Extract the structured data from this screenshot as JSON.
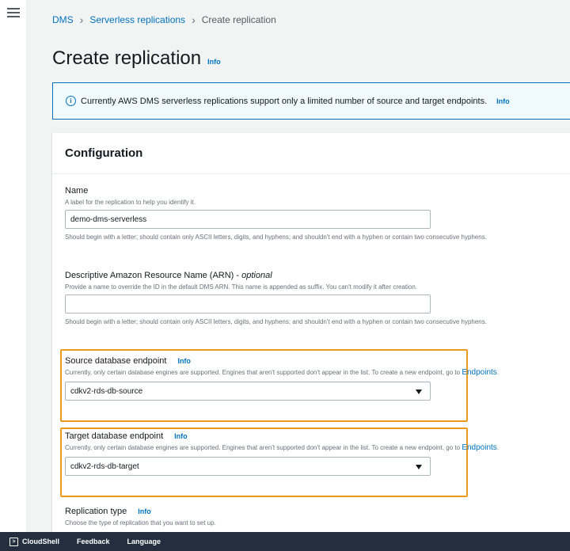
{
  "breadcrumb": {
    "items": [
      "DMS",
      "Serverless replications"
    ],
    "current": "Create replication"
  },
  "page": {
    "title": "Create replication",
    "info": "Info"
  },
  "flash": {
    "text": "Currently AWS DMS serverless replications support only a limited number of source and target endpoints.",
    "info": "Info"
  },
  "panel": {
    "title": "Configuration",
    "name": {
      "label": "Name",
      "description": "A label for the replication to help you identify it.",
      "value": "demo-dms-serverless",
      "constraint": "Should begin with a letter; should contain only ASCII letters, digits, and hyphens; and shouldn't end with a hyphen or contain two consecutive hyphens."
    },
    "arn": {
      "label": "Descriptive Amazon Resource Name (ARN) -",
      "optional": "optional",
      "description": "Provide a name to override the ID in the default DMS ARN. This name is appended as suffix. You can't modify it after creation.",
      "value": "",
      "constraint": "Should begin with a letter; should contain only ASCII letters, digits, and hyphens; and shouldn't end with a hyphen or contain two consecutive hyphens."
    },
    "source": {
      "label": "Source database endpoint",
      "info": "Info",
      "description": "Currently, only certain database engines are supported. Engines that aren't supported don't appear in the list. To create a new endpoint, go to",
      "link": "Endpoints",
      "value": "cdkv2-rds-db-source"
    },
    "target": {
      "label": "Target database endpoint",
      "info": "Info",
      "description": "Currently, only certain database engines are supported. Engines that aren't supported don't appear in the list. To create a new endpoint, go to",
      "link": "Endpoints",
      "value": "cdkv2-rds-db-target"
    },
    "replication_type": {
      "label": "Replication type",
      "info": "Info",
      "description": "Choose the type of replication that you want to set up."
    }
  },
  "bottombar": {
    "cloudshell": "CloudShell",
    "feedback": "Feedback",
    "language": "Language"
  },
  "colors": {
    "accent_link": "#0073bb",
    "highlight_border": "#ec9a1e",
    "bottombar_bg": "#232f3e"
  },
  "icons": [
    "menu-icon",
    "info-circle-icon",
    "caret-down-icon",
    "cloudshell-icon",
    "chevron-right-icon"
  ]
}
